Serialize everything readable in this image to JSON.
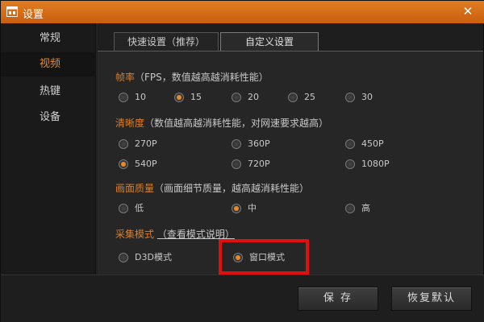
{
  "window": {
    "title": "设置",
    "close_glyph": "✕"
  },
  "sidebar": {
    "items": [
      {
        "label": "常规",
        "active": false
      },
      {
        "label": "视频",
        "active": true
      },
      {
        "label": "热键",
        "active": false
      },
      {
        "label": "设备",
        "active": false
      }
    ]
  },
  "tabs": [
    {
      "label": "快速设置（推荐）",
      "active": false
    },
    {
      "label": "自定义设置",
      "active": true
    }
  ],
  "framerate": {
    "title": "帧率",
    "note": "（FPS，数值越高越消耗性能）",
    "options": [
      "10",
      "15",
      "20",
      "25",
      "30"
    ],
    "selected": "15"
  },
  "resolution": {
    "title": "清晰度",
    "note": "（数值越高越消耗性能，对网速要求越高）",
    "options": [
      "270P",
      "360P",
      "450P",
      "540P",
      "720P",
      "1080P"
    ],
    "selected": "540P"
  },
  "quality": {
    "title": "画面质量",
    "note": "（画面细节质量，越高越消耗性能）",
    "options": [
      "低",
      "中",
      "高"
    ],
    "selected": "中"
  },
  "capture": {
    "title": "采集模式",
    "help_link": "（查看模式说明）",
    "options": [
      "D3D模式",
      "窗口模式"
    ],
    "selected": "窗口模式"
  },
  "footer": {
    "save_label": "保 存",
    "restore_label": "恢复默认"
  },
  "colors": {
    "accent": "#e07d22",
    "highlight": "#e01010"
  },
  "icons": {
    "title": "settings-window-icon",
    "close": "close-icon"
  }
}
